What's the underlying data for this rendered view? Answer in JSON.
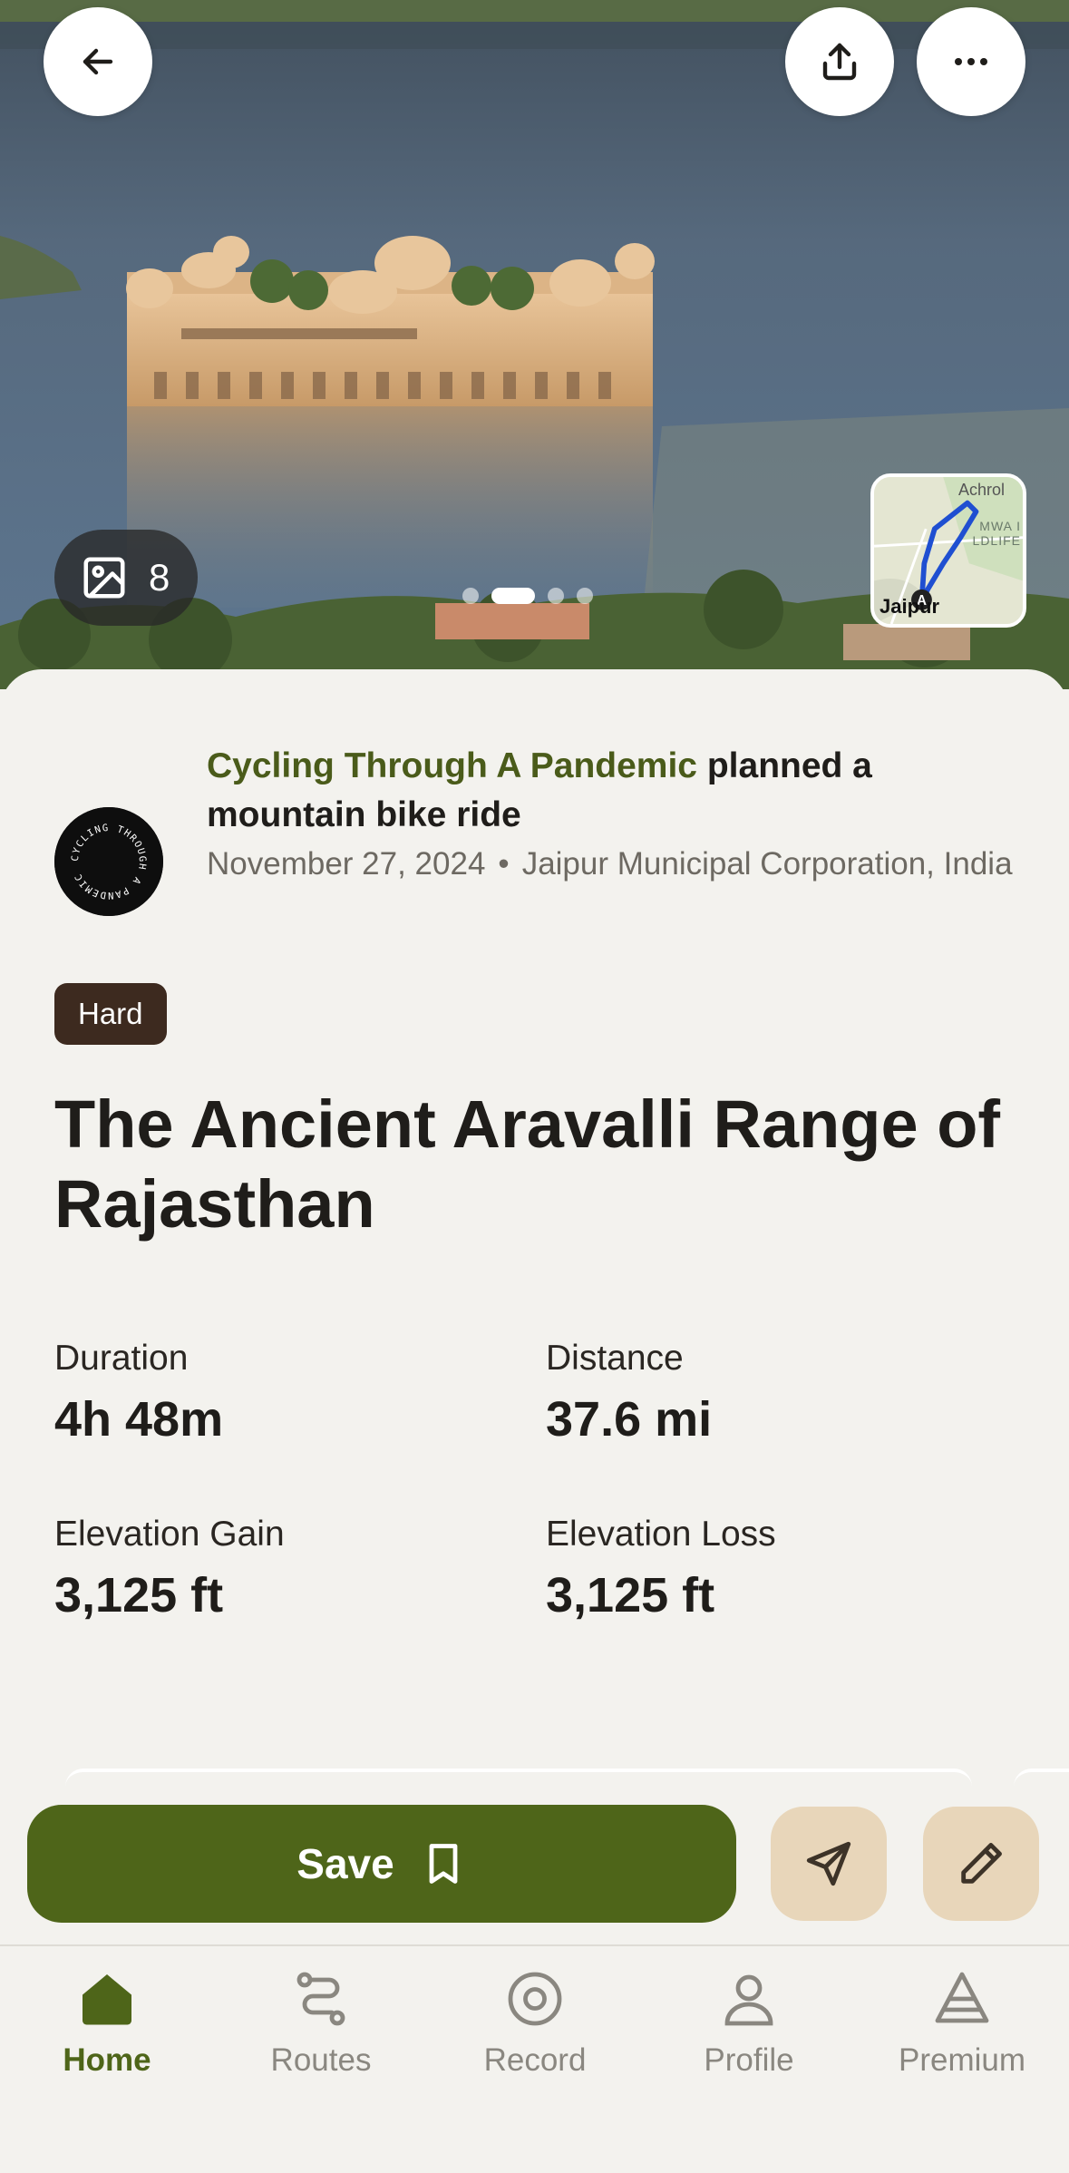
{
  "hero": {
    "photo_count": "8",
    "carousel_pages": 4,
    "carousel_active_index": 1,
    "map_labels": {
      "top": "Achrol",
      "middle_1": "MWA I",
      "middle_2": "LDLIFE",
      "bottom": "Jaipur",
      "start_marker": "A"
    }
  },
  "header_icons": {
    "back": "arrow-left-icon",
    "share": "share-icon",
    "more": "more-horizontal-icon"
  },
  "author": {
    "name": "Cycling Through A Pandemic",
    "action": "planned a mountain bike ride",
    "date": "November 27, 2024",
    "separator": "•",
    "location": "Jaipur Municipal Corporation, India",
    "avatar_text": "CYCLING THROUGH A PANDEMIC"
  },
  "route": {
    "difficulty": "Hard",
    "title": "The Ancient Aravalli Range of Rajasthan"
  },
  "stats": [
    {
      "label": "Duration",
      "value": "4h 48m"
    },
    {
      "label": "Distance",
      "value": "37.6 mi"
    },
    {
      "label": "Elevation Gain",
      "value": "3,125 ft"
    },
    {
      "label": "Elevation Loss",
      "value": "3,125 ft"
    }
  ],
  "actions": {
    "save_label": "Save",
    "save_icon": "bookmark-icon",
    "navigate_icon": "navigation-icon",
    "edit_icon": "pencil-icon"
  },
  "tabs": [
    {
      "label": "Home",
      "icon": "home-icon",
      "active": true
    },
    {
      "label": "Routes",
      "icon": "routes-icon",
      "active": false
    },
    {
      "label": "Record",
      "icon": "record-icon",
      "active": false
    },
    {
      "label": "Profile",
      "icon": "profile-icon",
      "active": false
    },
    {
      "label": "Premium",
      "icon": "premium-icon",
      "active": false
    }
  ],
  "colors": {
    "brand_green": "#4e6519",
    "author_green": "#4a5b1a",
    "badge_brown": "#3d2a1f",
    "secondary_button": "#e8d6ba",
    "background": "#f3f2ee"
  }
}
